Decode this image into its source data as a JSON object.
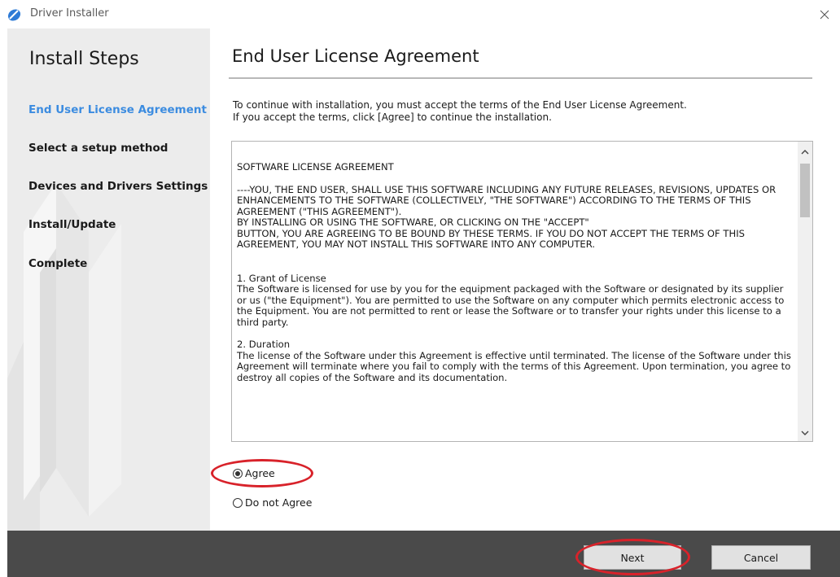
{
  "window": {
    "title": "Driver Installer",
    "close_glyph": "✕"
  },
  "sidebar": {
    "title": "Install Steps",
    "steps": [
      {
        "label": "End User License Agreement",
        "active": true
      },
      {
        "label": "Select a setup method",
        "active": false
      },
      {
        "label": "Devices and Drivers Settings",
        "active": false
      },
      {
        "label": "Install/Update",
        "active": false
      },
      {
        "label": "Complete",
        "active": false
      }
    ]
  },
  "main": {
    "title": "End User License Agreement",
    "intro_line1": "To continue with installation, you must accept the terms of the End User License Agreement.",
    "intro_line2": "If you accept the terms, click [Agree] to continue the installation.",
    "license": {
      "heading": "SOFTWARE LICENSE AGREEMENT",
      "para1": "----YOU, THE END USER, SHALL USE THIS SOFTWARE INCLUDING ANY FUTURE RELEASES, REVISIONS, UPDATES OR ENHANCEMENTS TO THE SOFTWARE (COLLECTIVELY, \"THE SOFTWARE\") ACCORDING TO THE TERMS OF THIS AGREEMENT (\"THIS AGREEMENT\").",
      "para1b": "BY INSTALLING OR USING THE SOFTWARE, OR CLICKING ON THE \"ACCEPT\"",
      "para1c": "BUTTON, YOU ARE AGREEING TO BE BOUND BY THESE TERMS. IF YOU DO NOT ACCEPT THE TERMS OF THIS AGREEMENT, YOU MAY NOT INSTALL THIS SOFTWARE INTO ANY COMPUTER.",
      "section1_title": "1. Grant of License",
      "section1_body": "The Software is licensed for use by you for the equipment packaged with the Software or designated by its supplier or us (\"the Equipment\"). You are permitted to use the Software on any computer which permits electronic access to the Equipment. You are not permitted to rent or lease the Software or to transfer your rights under this license to a third party.",
      "section2_title": "2. Duration",
      "section2_body": "The license of the Software under this Agreement is effective until terminated. The license of the Software under this Agreement will terminate where you fail to comply with the terms of this Agreement. Upon termination, you agree to destroy all copies of the Software and its documentation."
    },
    "options": {
      "agree": {
        "label": "Agree",
        "checked": true
      },
      "disagree": {
        "label": "Do not Agree",
        "checked": false
      }
    }
  },
  "footer": {
    "next_label": "Next",
    "cancel_label": "Cancel"
  },
  "colors": {
    "active_step": "#3c8ce0",
    "highlight": "#d8222a",
    "footer_bg": "#4a4a4a",
    "sidebar_bg": "#ececec"
  }
}
